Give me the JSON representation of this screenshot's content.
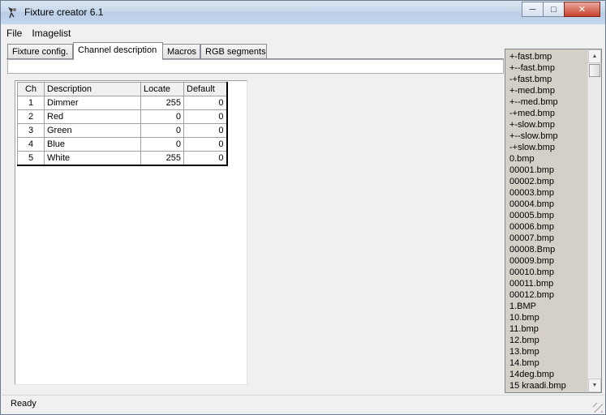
{
  "window": {
    "title": "Fixture creator 6.1"
  },
  "menu": [
    "File",
    "Imagelist"
  ],
  "tabs": [
    "Fixture config.",
    "Channel description",
    "Macros",
    "RGB segments"
  ],
  "active_tab": "Channel description",
  "description_input": {
    "value": ""
  },
  "channel_table": {
    "headers": [
      "Ch",
      "Description",
      "Locate",
      "Default"
    ],
    "rows": [
      {
        "ch": "1",
        "description": "Dimmer",
        "locate": "255",
        "default": "0"
      },
      {
        "ch": "2",
        "description": "Red",
        "locate": "0",
        "default": "0"
      },
      {
        "ch": "3",
        "description": "Green",
        "locate": "0",
        "default": "0"
      },
      {
        "ch": "4",
        "description": "Blue",
        "locate": "0",
        "default": "0"
      },
      {
        "ch": "5",
        "description": "White",
        "locate": "255",
        "default": "0"
      }
    ]
  },
  "image_list": [
    "+-fast.bmp",
    "+--fast.bmp",
    "-+fast.bmp",
    "+-med.bmp",
    "+--med.bmp",
    "-+med.bmp",
    "+-slow.bmp",
    "+--slow.bmp",
    "-+slow.bmp",
    "0.bmp",
    "00001.bmp",
    "00002.bmp",
    "00003.bmp",
    "00004.bmp",
    "00005.bmp",
    "00006.bmp",
    "00007.bmp",
    "00008.Bmp",
    "00009.bmp",
    "00010.bmp",
    "00011.bmp",
    "00012.bmp",
    "1.BMP",
    "10.bmp",
    "11.bmp",
    "12.bmp",
    "13.bmp",
    "14.bmp",
    "14deg.bmp",
    "15 kraadi.bmp"
  ],
  "status": {
    "text": "Ready"
  },
  "icons": {
    "app": "fixture-lamp-icon",
    "minimize": "minimize-icon",
    "maximize": "maximize-icon",
    "close": "close-icon"
  }
}
